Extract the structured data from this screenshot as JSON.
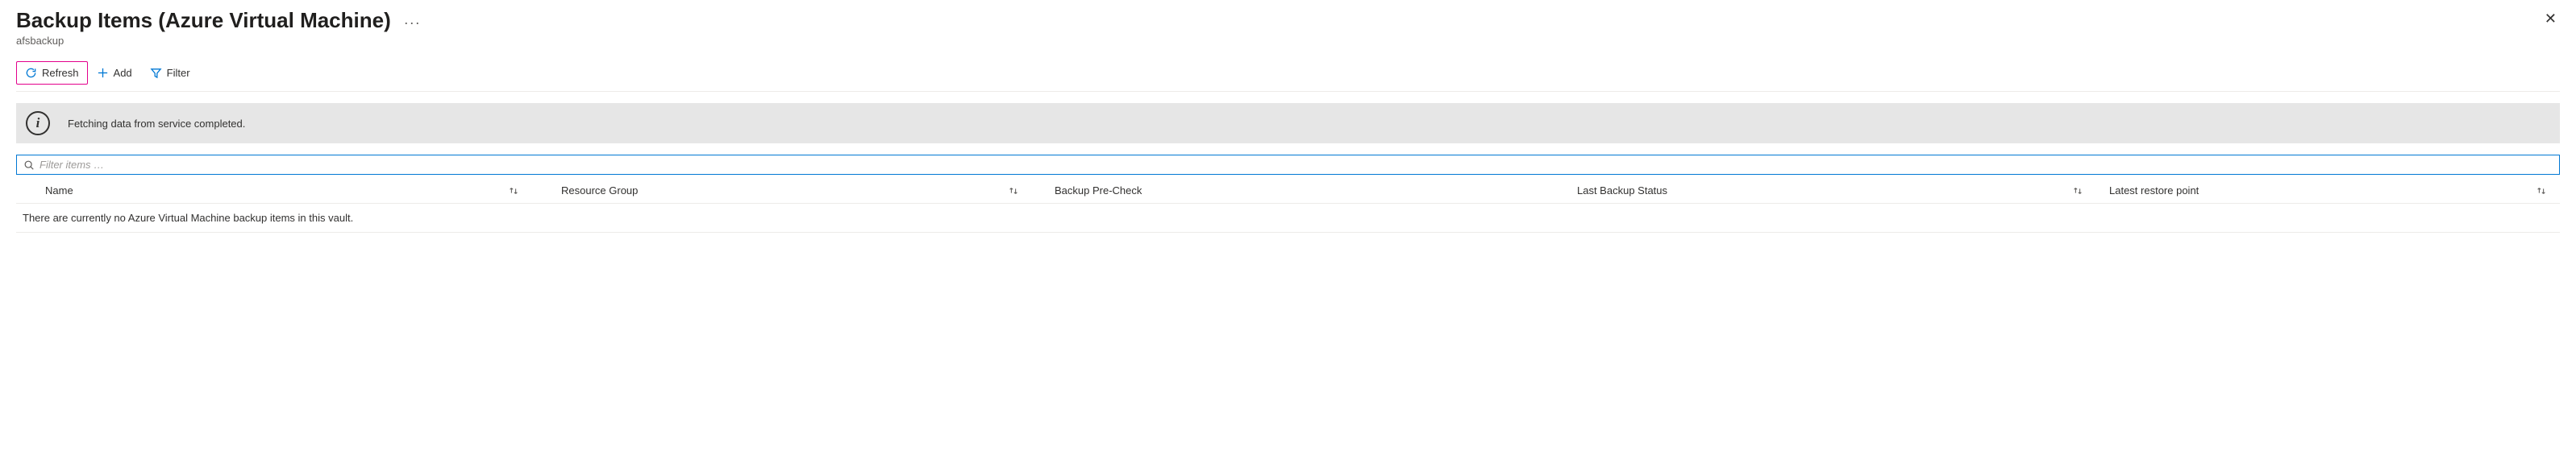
{
  "header": {
    "title": "Backup Items (Azure Virtual Machine)",
    "subtitle": "afsbackup",
    "more_label": "···"
  },
  "toolbar": {
    "refresh": "Refresh",
    "add": "Add",
    "filter": "Filter"
  },
  "info": {
    "message": "Fetching data from service completed."
  },
  "filter": {
    "placeholder": "Filter items …"
  },
  "columns": {
    "name": "Name",
    "resource_group": "Resource Group",
    "backup_pre_check": "Backup Pre-Check",
    "last_backup_status": "Last Backup Status",
    "latest_restore_point": "Latest restore point"
  },
  "empty_message": "There are currently no Azure Virtual Machine backup items in this vault.",
  "icons": {
    "close": "✕"
  }
}
